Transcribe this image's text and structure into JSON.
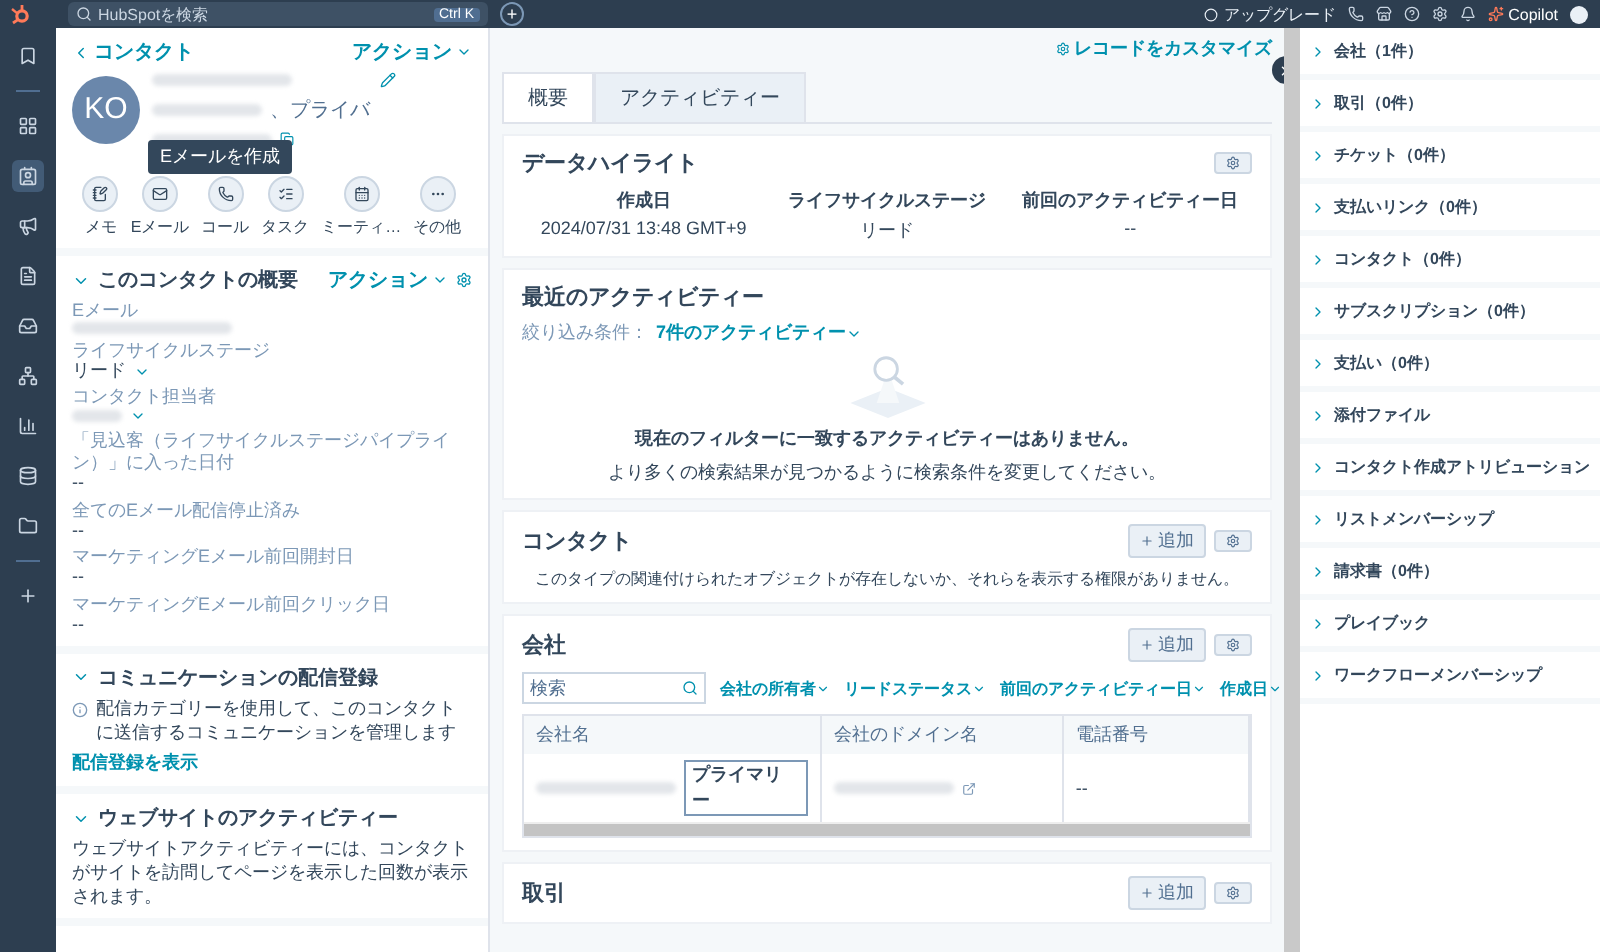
{
  "topbar": {
    "search_placeholder": "HubSpotを検索",
    "shortcut": "Ctrl K",
    "add": "+",
    "upgrade": "アップグレード",
    "copilot": "Copilot"
  },
  "contact": {
    "back": "コンタクト",
    "actions": "アクション",
    "initials": "KO",
    "subtitle": "、プライバ",
    "tooltip": "Eメールを作成",
    "quick_actions": [
      {
        "label": "メモ",
        "kind": "note"
      },
      {
        "label": "Eメール",
        "kind": "email"
      },
      {
        "label": "コール",
        "kind": "call"
      },
      {
        "label": "タスク",
        "kind": "task"
      },
      {
        "label": "ミーティ…",
        "kind": "meeting"
      },
      {
        "label": "その他",
        "kind": "more"
      }
    ]
  },
  "summary": {
    "title": "このコンタクトの概要",
    "actions": "アクション",
    "expanded": true,
    "fields": [
      {
        "label": "Eメール"
      },
      {
        "label": "ライフサイクルステージ",
        "value": "リード",
        "kind": "dropdown"
      },
      {
        "label": "コンタクト担当者",
        "kind": "dropdown"
      },
      {
        "label": "「見込客（ライフサイクルステージパイプライン）」に入った日付",
        "value": "--",
        "kind": "text"
      },
      {
        "label": "全てのEメール配信停止済み",
        "value": "--",
        "kind": "text"
      },
      {
        "label": "マーケティングEメール前回開封日",
        "value": "--",
        "kind": "text"
      },
      {
        "label": "マーケティングEメール前回クリック日",
        "value": "--",
        "kind": "text"
      }
    ]
  },
  "subscriptions": {
    "title": "コミュニケーションの配信登録",
    "expanded": true,
    "text": "配信カテゴリーを使用して、このコンタクトに送信するコミュニケーションを管理します",
    "link": "配信登録を表示"
  },
  "website": {
    "title": "ウェブサイトのアクティビティー",
    "expanded": true,
    "text": "ウェブサイトアクティビティーには、コンタクトがサイトを訪問してページを表示した回数が表示されます。"
  },
  "customize": "レコードをカスタマイズ",
  "tabs": [
    {
      "label": "概要",
      "selected": true
    },
    {
      "label": "アクティビティー",
      "selected": false
    }
  ],
  "highlights": {
    "title": "データハイライト",
    "items": [
      {
        "label": "作成日",
        "value": "2024/07/31 13:48 GMT+9"
      },
      {
        "label": "ライフサイクルステージ",
        "value": "リード"
      },
      {
        "label": "前回のアクティビティー日",
        "value": "--"
      }
    ]
  },
  "recent": {
    "title": "最近のアクティビティー",
    "filter_label": "絞り込み条件：",
    "filter": "7件のアクティビティー",
    "empty_title": "現在のフィルターに一致するアクティビティーはありません。",
    "empty_text": "より多くの検索結果が見つかるように検索条件を変更してください。"
  },
  "contacts_card": {
    "title": "コンタクト",
    "add": "追加",
    "empty": "このタイプの関連付けられたオブジェクトが存在しないか、それらを表示する権限がありません。"
  },
  "companies": {
    "title": "会社",
    "add": "追加",
    "search_placeholder": "検索",
    "filters": [
      "会社の所有者",
      "リードステータス",
      "前回のアクティビティー日",
      "作成日"
    ],
    "columns": [
      "会社名",
      "会社のドメイン名",
      "電話番号"
    ],
    "rows": [
      {
        "badge": "プライマリー",
        "phone": "--"
      }
    ]
  },
  "deals": {
    "title": "取引",
    "add": "追加"
  },
  "sidebar": {
    "items": [
      {
        "label": "会社（1件）",
        "expanded": false
      },
      {
        "label": "取引（0件）",
        "expanded": false
      },
      {
        "label": "チケット（0件）",
        "expanded": false
      },
      {
        "label": "支払いリンク（0件）",
        "expanded": false
      },
      {
        "label": "コンタクト（0件）",
        "expanded": false
      },
      {
        "label": "サブスクリプション（0件）",
        "expanded": false
      },
      {
        "label": "支払い（0件）",
        "expanded": false
      },
      {
        "label": "添付ファイル",
        "expanded": false
      },
      {
        "label": "コンタクト作成アトリビューション",
        "expanded": false
      },
      {
        "label": "リストメンバーシップ",
        "expanded": false
      },
      {
        "label": "請求書（0件）",
        "expanded": false
      },
      {
        "label": "プレイブック",
        "expanded": false
      },
      {
        "label": "ワークフローメンバーシップ",
        "expanded": false
      }
    ]
  }
}
